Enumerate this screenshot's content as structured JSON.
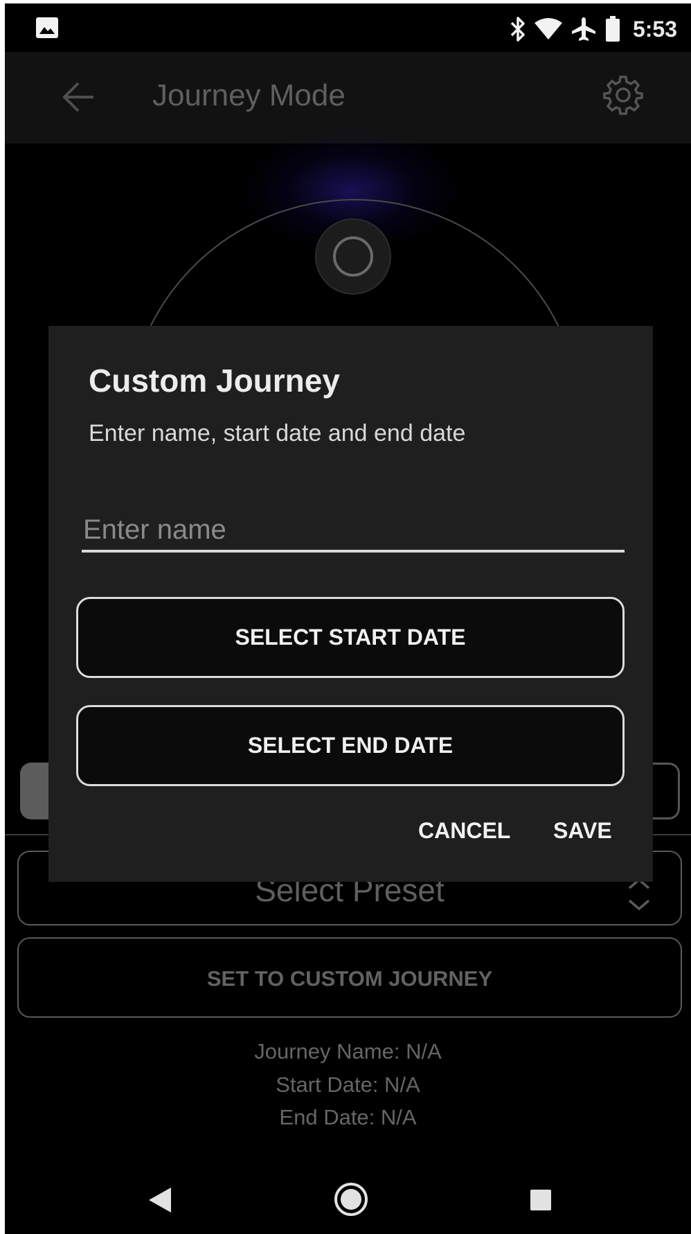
{
  "status_bar": {
    "time": "5:53",
    "icons": [
      "gallery-icon",
      "bluetooth-icon",
      "wifi-icon",
      "airplane-icon",
      "battery-icon"
    ]
  },
  "app_bar": {
    "title": "Journey Mode",
    "back_icon": "arrow-left",
    "settings_icon": "gear"
  },
  "background": {
    "preset_select": {
      "value": "Select Preset"
    },
    "custom_button_label": "SET TO CUSTOM JOURNEY",
    "info": {
      "journey_name": "Journey Name: N/A",
      "start_date": "Start Date: N/A",
      "end_date": "End Date: N/A"
    }
  },
  "dialog": {
    "title": "Custom Journey",
    "subtitle": "Enter name, start date and end date",
    "name_input": {
      "value": "",
      "placeholder": "Enter name"
    },
    "start_date_button": "SELECT START DATE",
    "end_date_button": "SELECT END DATE",
    "cancel": "CANCEL",
    "save": "SAVE"
  },
  "nav_bar": {
    "icons": [
      "nav-back-icon",
      "nav-home-icon",
      "nav-recents-icon"
    ]
  },
  "colors": {
    "background": "#000000",
    "app_bar": "#121212",
    "dialog": "#1f1f1f",
    "text_primary": "#ececec",
    "text_muted": "#5f5f5f",
    "accent_glow": "#281e96"
  }
}
